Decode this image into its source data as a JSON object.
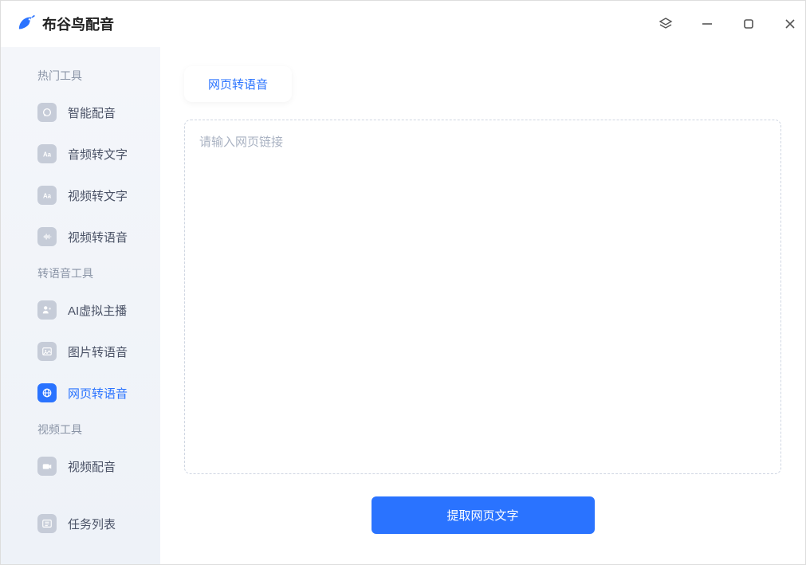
{
  "app": {
    "title": "布谷鸟配音"
  },
  "sidebar": {
    "groups": [
      {
        "title": "热门工具",
        "items": [
          {
            "key": "smart-dub",
            "label": "智能配音",
            "icon": "mic"
          },
          {
            "key": "audio-to-text",
            "label": "音频转文字",
            "icon": "aa"
          },
          {
            "key": "video-to-text",
            "label": "视频转文字",
            "icon": "aa"
          },
          {
            "key": "video-to-speech",
            "label": "视频转语音",
            "icon": "wave"
          }
        ]
      },
      {
        "title": "转语音工具",
        "items": [
          {
            "key": "ai-anchor",
            "label": "AI虚拟主播",
            "icon": "person"
          },
          {
            "key": "image-to-speech",
            "label": "图片转语音",
            "icon": "image"
          },
          {
            "key": "web-to-speech",
            "label": "网页转语音",
            "icon": "globe",
            "active": true
          }
        ]
      },
      {
        "title": "视频工具",
        "items": [
          {
            "key": "video-dub",
            "label": "视频配音",
            "icon": "camera"
          }
        ]
      },
      {
        "title": "",
        "items": [
          {
            "key": "task-list",
            "label": "任务列表",
            "icon": "list"
          }
        ]
      }
    ]
  },
  "main": {
    "tab_label": "网页转语音",
    "input_placeholder": "请输入网页链接",
    "input_value": "",
    "button_label": "提取网页文字"
  }
}
